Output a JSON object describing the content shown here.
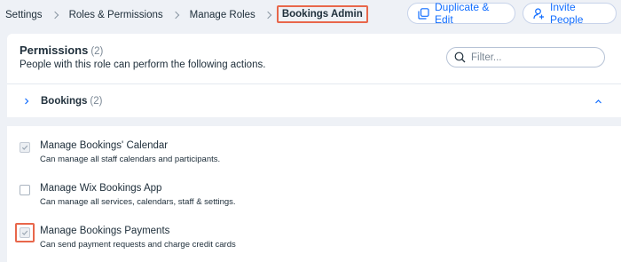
{
  "breadcrumb": {
    "items": [
      "Settings",
      "Roles & Permissions",
      "Manage Roles"
    ],
    "current": "Bookings Admin"
  },
  "actions": {
    "duplicate_label": "Duplicate & Edit",
    "invite_label": "Invite People"
  },
  "permissions": {
    "title": "Permissions",
    "count": "(2)",
    "subtitle": "People with this role can perform the following actions.",
    "filter_placeholder": "Filter..."
  },
  "section": {
    "label": "Bookings",
    "count": "(2)"
  },
  "items": [
    {
      "name": "Manage Bookings' Calendar",
      "desc": "Can manage all staff calendars and participants.",
      "checked": true
    },
    {
      "name": "Manage Wix Bookings App",
      "desc": "Can manage all services, calendars, staff & settings.",
      "checked": false
    },
    {
      "name": "Manage Bookings Payments",
      "desc": "Can send payment requests and charge credit cards",
      "checked": true
    }
  ],
  "colors": {
    "accent": "#116dff",
    "highlight": "#e8674b",
    "background": "#eef1f6"
  }
}
